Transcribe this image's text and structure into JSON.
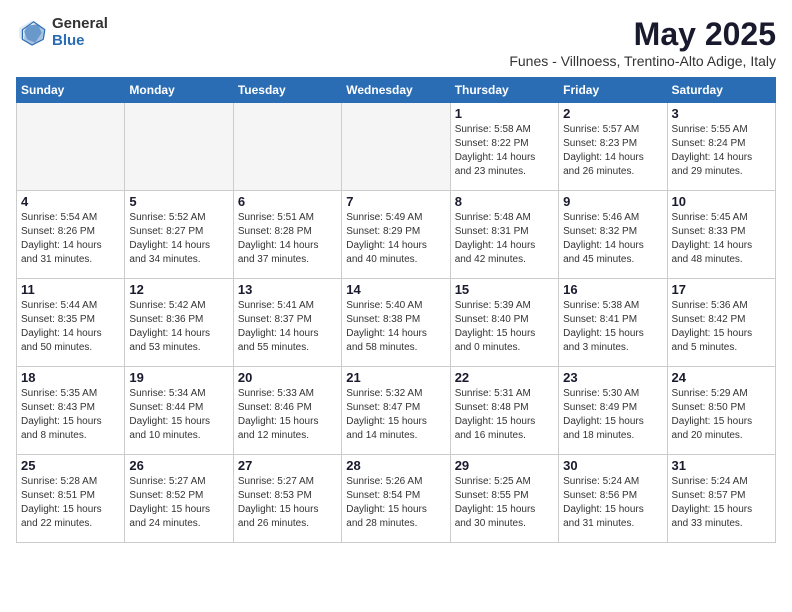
{
  "logo": {
    "general": "General",
    "blue": "Blue"
  },
  "title": "May 2025",
  "subtitle": "Funes - Villnoess, Trentino-Alto Adige, Italy",
  "days_header": [
    "Sunday",
    "Monday",
    "Tuesday",
    "Wednesday",
    "Thursday",
    "Friday",
    "Saturday"
  ],
  "weeks": [
    [
      {
        "day": "",
        "info": ""
      },
      {
        "day": "",
        "info": ""
      },
      {
        "day": "",
        "info": ""
      },
      {
        "day": "",
        "info": ""
      },
      {
        "day": "1",
        "info": "Sunrise: 5:58 AM\nSunset: 8:22 PM\nDaylight: 14 hours\nand 23 minutes."
      },
      {
        "day": "2",
        "info": "Sunrise: 5:57 AM\nSunset: 8:23 PM\nDaylight: 14 hours\nand 26 minutes."
      },
      {
        "day": "3",
        "info": "Sunrise: 5:55 AM\nSunset: 8:24 PM\nDaylight: 14 hours\nand 29 minutes."
      }
    ],
    [
      {
        "day": "4",
        "info": "Sunrise: 5:54 AM\nSunset: 8:26 PM\nDaylight: 14 hours\nand 31 minutes."
      },
      {
        "day": "5",
        "info": "Sunrise: 5:52 AM\nSunset: 8:27 PM\nDaylight: 14 hours\nand 34 minutes."
      },
      {
        "day": "6",
        "info": "Sunrise: 5:51 AM\nSunset: 8:28 PM\nDaylight: 14 hours\nand 37 minutes."
      },
      {
        "day": "7",
        "info": "Sunrise: 5:49 AM\nSunset: 8:29 PM\nDaylight: 14 hours\nand 40 minutes."
      },
      {
        "day": "8",
        "info": "Sunrise: 5:48 AM\nSunset: 8:31 PM\nDaylight: 14 hours\nand 42 minutes."
      },
      {
        "day": "9",
        "info": "Sunrise: 5:46 AM\nSunset: 8:32 PM\nDaylight: 14 hours\nand 45 minutes."
      },
      {
        "day": "10",
        "info": "Sunrise: 5:45 AM\nSunset: 8:33 PM\nDaylight: 14 hours\nand 48 minutes."
      }
    ],
    [
      {
        "day": "11",
        "info": "Sunrise: 5:44 AM\nSunset: 8:35 PM\nDaylight: 14 hours\nand 50 minutes."
      },
      {
        "day": "12",
        "info": "Sunrise: 5:42 AM\nSunset: 8:36 PM\nDaylight: 14 hours\nand 53 minutes."
      },
      {
        "day": "13",
        "info": "Sunrise: 5:41 AM\nSunset: 8:37 PM\nDaylight: 14 hours\nand 55 minutes."
      },
      {
        "day": "14",
        "info": "Sunrise: 5:40 AM\nSunset: 8:38 PM\nDaylight: 14 hours\nand 58 minutes."
      },
      {
        "day": "15",
        "info": "Sunrise: 5:39 AM\nSunset: 8:40 PM\nDaylight: 15 hours\nand 0 minutes."
      },
      {
        "day": "16",
        "info": "Sunrise: 5:38 AM\nSunset: 8:41 PM\nDaylight: 15 hours\nand 3 minutes."
      },
      {
        "day": "17",
        "info": "Sunrise: 5:36 AM\nSunset: 8:42 PM\nDaylight: 15 hours\nand 5 minutes."
      }
    ],
    [
      {
        "day": "18",
        "info": "Sunrise: 5:35 AM\nSunset: 8:43 PM\nDaylight: 15 hours\nand 8 minutes."
      },
      {
        "day": "19",
        "info": "Sunrise: 5:34 AM\nSunset: 8:44 PM\nDaylight: 15 hours\nand 10 minutes."
      },
      {
        "day": "20",
        "info": "Sunrise: 5:33 AM\nSunset: 8:46 PM\nDaylight: 15 hours\nand 12 minutes."
      },
      {
        "day": "21",
        "info": "Sunrise: 5:32 AM\nSunset: 8:47 PM\nDaylight: 15 hours\nand 14 minutes."
      },
      {
        "day": "22",
        "info": "Sunrise: 5:31 AM\nSunset: 8:48 PM\nDaylight: 15 hours\nand 16 minutes."
      },
      {
        "day": "23",
        "info": "Sunrise: 5:30 AM\nSunset: 8:49 PM\nDaylight: 15 hours\nand 18 minutes."
      },
      {
        "day": "24",
        "info": "Sunrise: 5:29 AM\nSunset: 8:50 PM\nDaylight: 15 hours\nand 20 minutes."
      }
    ],
    [
      {
        "day": "25",
        "info": "Sunrise: 5:28 AM\nSunset: 8:51 PM\nDaylight: 15 hours\nand 22 minutes."
      },
      {
        "day": "26",
        "info": "Sunrise: 5:27 AM\nSunset: 8:52 PM\nDaylight: 15 hours\nand 24 minutes."
      },
      {
        "day": "27",
        "info": "Sunrise: 5:27 AM\nSunset: 8:53 PM\nDaylight: 15 hours\nand 26 minutes."
      },
      {
        "day": "28",
        "info": "Sunrise: 5:26 AM\nSunset: 8:54 PM\nDaylight: 15 hours\nand 28 minutes."
      },
      {
        "day": "29",
        "info": "Sunrise: 5:25 AM\nSunset: 8:55 PM\nDaylight: 15 hours\nand 30 minutes."
      },
      {
        "day": "30",
        "info": "Sunrise: 5:24 AM\nSunset: 8:56 PM\nDaylight: 15 hours\nand 31 minutes."
      },
      {
        "day": "31",
        "info": "Sunrise: 5:24 AM\nSunset: 8:57 PM\nDaylight: 15 hours\nand 33 minutes."
      }
    ]
  ]
}
